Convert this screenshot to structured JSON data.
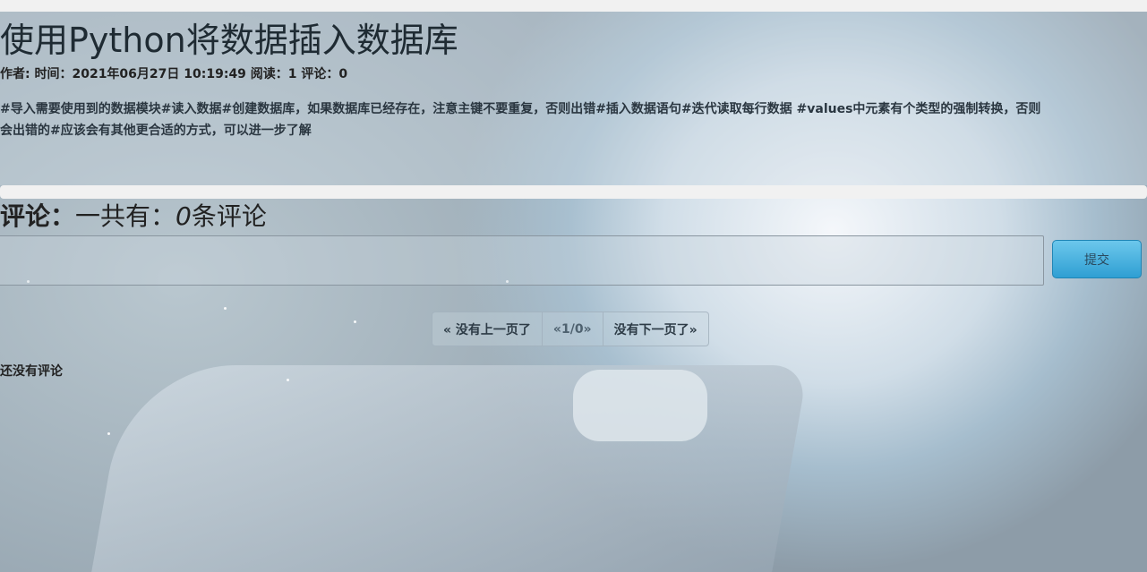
{
  "article": {
    "title": "使用Python将数据插入数据库",
    "meta": "作者: 时间：2021年06月27日 10:19:49 阅读：1 评论：0",
    "content_line1": "#导入需要使用到的数据模块#读入数据#创建数据库，如果数据库已经存在，注意主键不要重复，否则出错#插入数据语句#迭代读取每行数据 #values中元素有个类型的强制转换，否则",
    "content_line2": "会出错的#应该会有其他更合适的方式，可以进一步了解"
  },
  "comments": {
    "heading_label": "评论：",
    "heading_prefix": "一共有：",
    "count": "0",
    "heading_suffix": "条评论",
    "textarea_placeholder": "",
    "submit_label": "提交",
    "empty_text": "还没有评论"
  },
  "pagination": {
    "prev_label": "« 没有上一页了",
    "current_label": "«1/0»",
    "next_label": "没有下一页了»"
  },
  "colors": {
    "submit_button": "#3aa8dc",
    "page_background": "#f1f1f1"
  }
}
